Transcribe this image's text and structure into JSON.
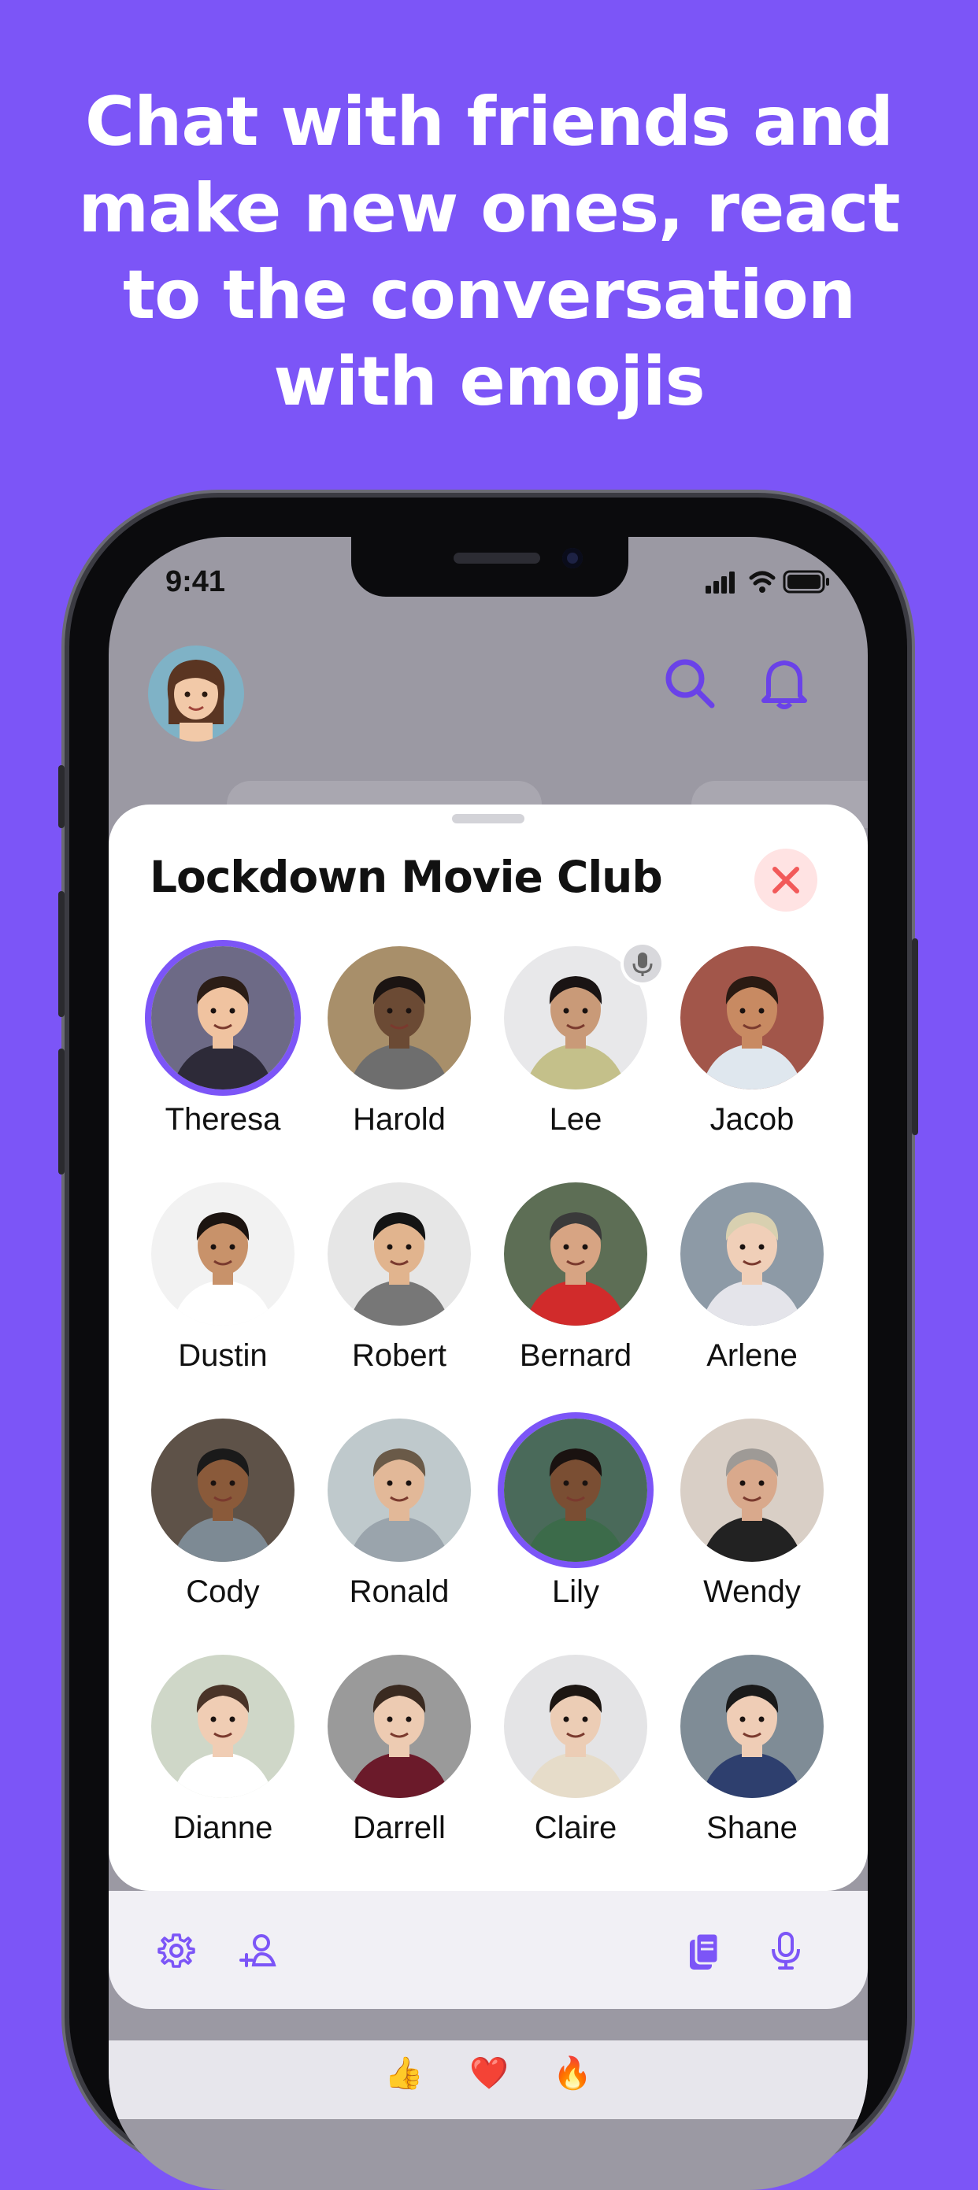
{
  "headline": [
    "Chat with friends and",
    "make new ones, react",
    "to the conversation",
    "with emojis"
  ],
  "status": {
    "time": "9:41"
  },
  "room": {
    "title": "Lockdown Movie Club",
    "members": [
      {
        "name": "Theresa",
        "speaking": true
      },
      {
        "name": "Harold",
        "speaking": false
      },
      {
        "name": "Lee",
        "speaking": false,
        "muted_icon": "mic-off-icon"
      },
      {
        "name": "Jacob",
        "speaking": false
      },
      {
        "name": "Dustin",
        "speaking": false
      },
      {
        "name": "Robert",
        "speaking": false
      },
      {
        "name": "Bernard",
        "speaking": false
      },
      {
        "name": "Arlene",
        "speaking": false
      },
      {
        "name": "Cody",
        "speaking": false
      },
      {
        "name": "Ronald",
        "speaking": false
      },
      {
        "name": "Lily",
        "speaking": true
      },
      {
        "name": "Wendy",
        "speaking": false
      },
      {
        "name": "Dianne",
        "speaking": false
      },
      {
        "name": "Darrell",
        "speaking": false
      },
      {
        "name": "Claire",
        "speaking": false
      },
      {
        "name": "Shane",
        "speaking": false
      }
    ]
  },
  "toolbar": {
    "icons": [
      "gear-icon",
      "add-person-icon",
      "clipboard-icon",
      "microphone-icon"
    ]
  },
  "reactions": [
    "👍",
    "❤️",
    "🔥"
  ],
  "colors": {
    "brand": "#7c55f7",
    "close": "#f25a5a",
    "close_bg": "#ffe3e3"
  }
}
